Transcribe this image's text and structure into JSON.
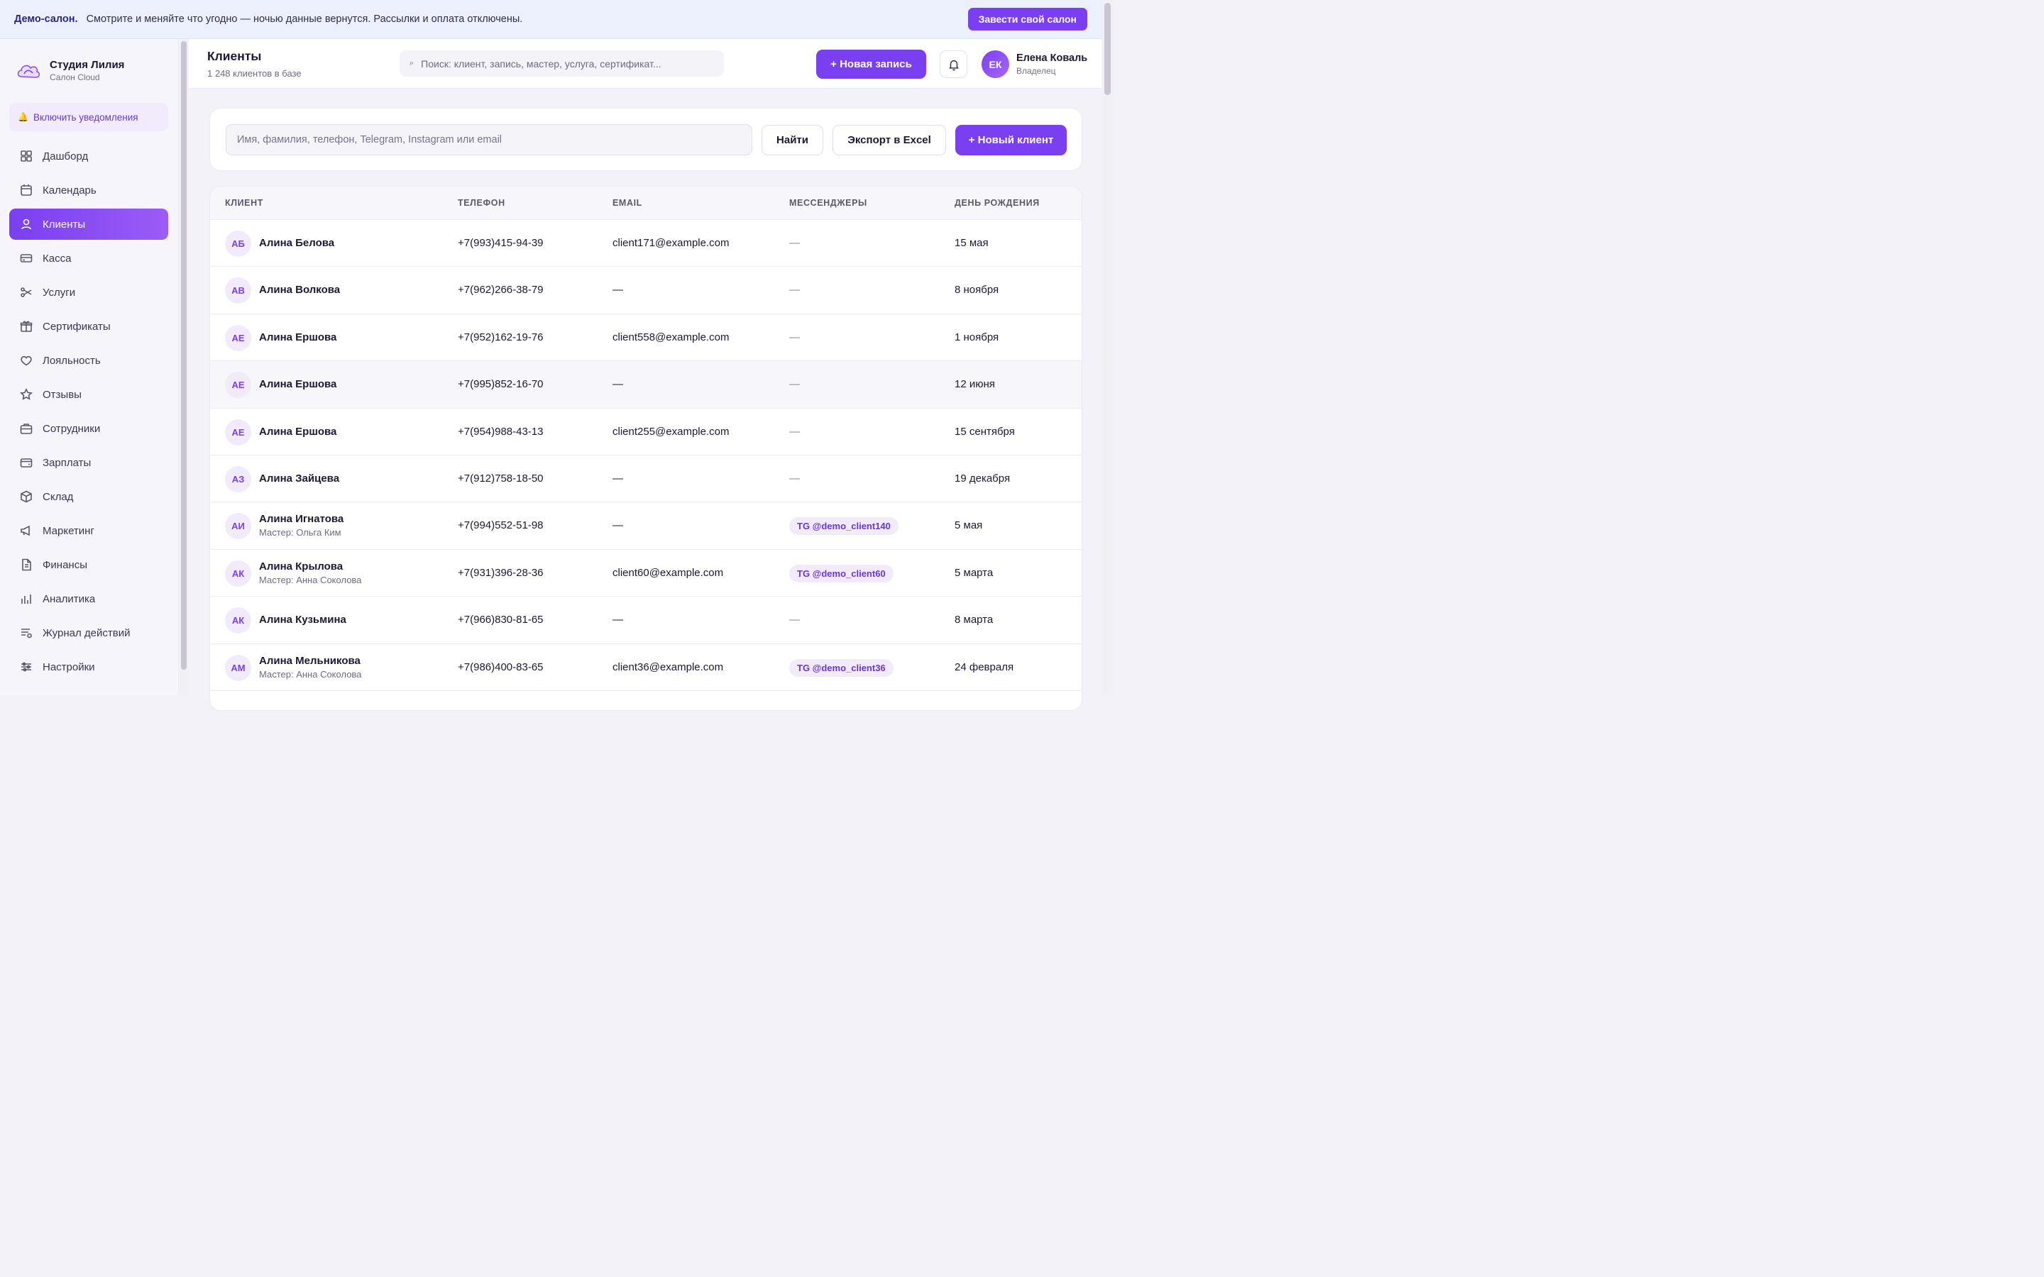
{
  "demo": {
    "strong": "Демо-салон.",
    "text": "Смотрите и меняйте что угодно — ночью данные вернутся. Рассылки и оплата отключены.",
    "cta": "Завести свой салон"
  },
  "brand": {
    "name": "Студия Лилия",
    "sub": "Салон Cloud"
  },
  "notify": {
    "label": "Включить уведомления"
  },
  "nav": [
    {
      "label": "Дашборд",
      "icon": "grid-icon"
    },
    {
      "label": "Календарь",
      "icon": "calendar-icon"
    },
    {
      "label": "Клиенты",
      "icon": "user-icon",
      "active": true
    },
    {
      "label": "Касса",
      "icon": "card-icon"
    },
    {
      "label": "Услуги",
      "icon": "scissors-icon"
    },
    {
      "label": "Сертификаты",
      "icon": "gift-icon"
    },
    {
      "label": "Лояльность",
      "icon": "heart-icon"
    },
    {
      "label": "Отзывы",
      "icon": "star-icon"
    },
    {
      "label": "Сотрудники",
      "icon": "briefcase-icon"
    },
    {
      "label": "Зарплаты",
      "icon": "wallet-icon"
    },
    {
      "label": "Склад",
      "icon": "box-icon"
    },
    {
      "label": "Маркетинг",
      "icon": "megaphone-icon"
    },
    {
      "label": "Финансы",
      "icon": "document-icon"
    },
    {
      "label": "Аналитика",
      "icon": "bar-chart-icon"
    },
    {
      "label": "Журнал действий",
      "icon": "log-icon"
    },
    {
      "label": "Настройки",
      "icon": "sliders-icon"
    }
  ],
  "header": {
    "title": "Клиенты",
    "subtitle": "1 248 клиентов в базе",
    "search_placeholder": "Поиск: клиент, запись, мастер, услуга, сертификат...",
    "new_record": "+ Новая запись",
    "user_initials": "ЕК",
    "user_name": "Елена Коваль",
    "user_role": "Владелец"
  },
  "filter": {
    "placeholder": "Имя, фамилия, телефон, Telegram, Instagram или email",
    "find": "Найти",
    "export": "Экспорт в Excel",
    "new_client": "+ Новый клиент"
  },
  "table": {
    "columns": [
      "КЛИЕНТ",
      "ТЕЛЕФОН",
      "EMAIL",
      "МЕССЕНДЖЕРЫ",
      "ДЕНЬ РОЖДЕНИЯ"
    ],
    "rows": [
      {
        "initials": "АБ",
        "name": "Алина Белова",
        "master": "",
        "phone": "+7(993)415-94-39",
        "email": "client171@example.com",
        "messenger": "",
        "birthday": "15 мая"
      },
      {
        "initials": "АВ",
        "name": "Алина Волкова",
        "master": "",
        "phone": "+7(962)266-38-79",
        "email": "",
        "messenger": "",
        "birthday": "8 ноября"
      },
      {
        "initials": "АЕ",
        "name": "Алина Ершова",
        "master": "",
        "phone": "+7(952)162-19-76",
        "email": "client558@example.com",
        "messenger": "",
        "birthday": "1 ноября"
      },
      {
        "initials": "АЕ",
        "name": "Алина Ершова",
        "master": "",
        "phone": "+7(995)852-16-70",
        "email": "",
        "messenger": "",
        "birthday": "12 июня",
        "hover": true
      },
      {
        "initials": "АЕ",
        "name": "Алина Ершова",
        "master": "",
        "phone": "+7(954)988-43-13",
        "email": "client255@example.com",
        "messenger": "",
        "birthday": "15 сентября"
      },
      {
        "initials": "АЗ",
        "name": "Алина Зайцева",
        "master": "",
        "phone": "+7(912)758-18-50",
        "email": "",
        "messenger": "",
        "birthday": "19 декабря"
      },
      {
        "initials": "АИ",
        "name": "Алина Игнатова",
        "master": "Мастер: Ольга Ким",
        "phone": "+7(994)552-51-98",
        "email": "",
        "messenger": "TG @demo_client140",
        "birthday": "5 мая"
      },
      {
        "initials": "АК",
        "name": "Алина Крылова",
        "master": "Мастер: Анна Соколова",
        "phone": "+7(931)396-28-36",
        "email": "client60@example.com",
        "messenger": "TG @demo_client60",
        "birthday": "5 марта"
      },
      {
        "initials": "АК",
        "name": "Алина Кузьмина",
        "master": "",
        "phone": "+7(966)830-81-65",
        "email": "",
        "messenger": "",
        "birthday": "8 марта"
      },
      {
        "initials": "АМ",
        "name": "Алина Мельникова",
        "master": "Мастер: Анна Соколова",
        "phone": "+7(986)400-83-65",
        "email": "client36@example.com",
        "messenger": "TG @demo_client36",
        "birthday": "24 февраля"
      }
    ],
    "empty": "—"
  }
}
